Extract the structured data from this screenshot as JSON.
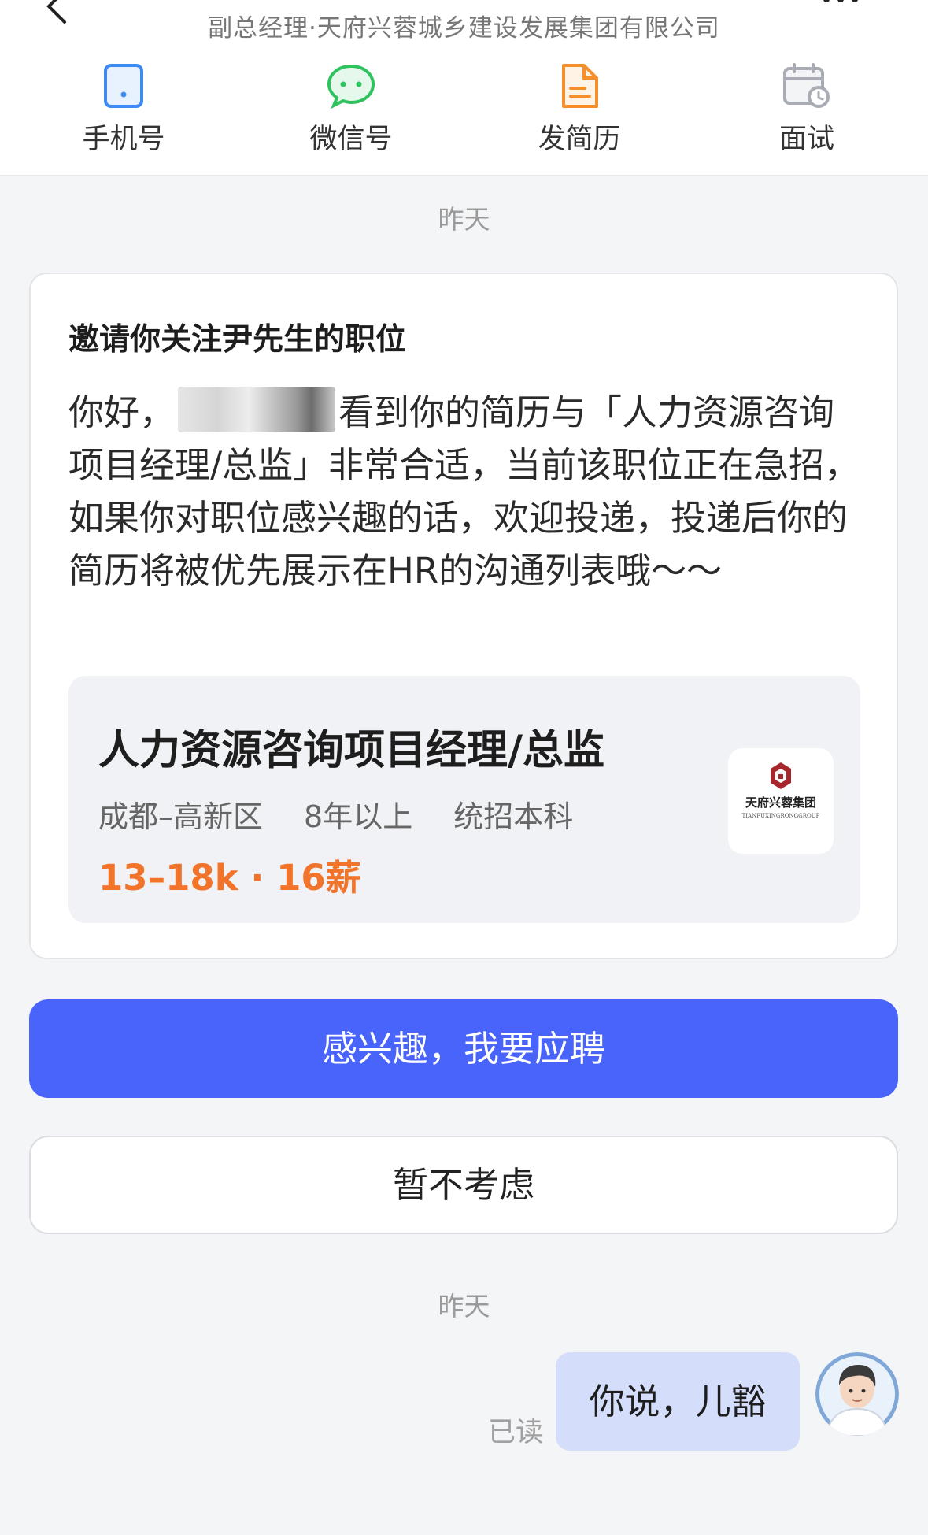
{
  "header": {
    "subtitle": "副总经理·天府兴蓉城乡建设发展集团有限公司",
    "back_icon": "back-arrow-icon",
    "more_icon": "more-dots-icon"
  },
  "actions": [
    {
      "label": "手机号",
      "icon": "phone-icon",
      "color": "#3d8bf2"
    },
    {
      "label": "微信号",
      "icon": "wechat-icon",
      "color": "#2fc35f"
    },
    {
      "label": "发简历",
      "icon": "resume-icon",
      "color": "#f58f2c"
    },
    {
      "label": "面试",
      "icon": "calendar-clock-icon",
      "color": "#a9acb5"
    }
  ],
  "dates": {
    "first": "昨天",
    "second": "昨天"
  },
  "invite": {
    "title": "邀请你关注尹先生的职位",
    "greeting": "你好，",
    "body": "看到你的简历与「人力资源咨询项目经理/总监」非常合适，当前该职位正在急招，如果你对职位感兴趣的话，欢迎投递，投递后你的简历将被优先展示在HR的沟通列表哦～～"
  },
  "job": {
    "title": "人力资源咨询项目经理/总监",
    "location": "成都–高新区",
    "experience": "8年以上",
    "education": "统招本科",
    "salary": "13–18k · 16薪",
    "logo_text": "天府兴蓉集团",
    "logo_subtext": "TIANFUXINGRONGGROUP"
  },
  "buttons": {
    "apply": "感兴趣，我要应聘",
    "decline": "暂不考虑"
  },
  "message": {
    "text": "你说，儿豁",
    "status": "已读"
  },
  "colors": {
    "primary": "#4864fb",
    "salary": "#f2742a",
    "bubble": "#d4defb"
  }
}
